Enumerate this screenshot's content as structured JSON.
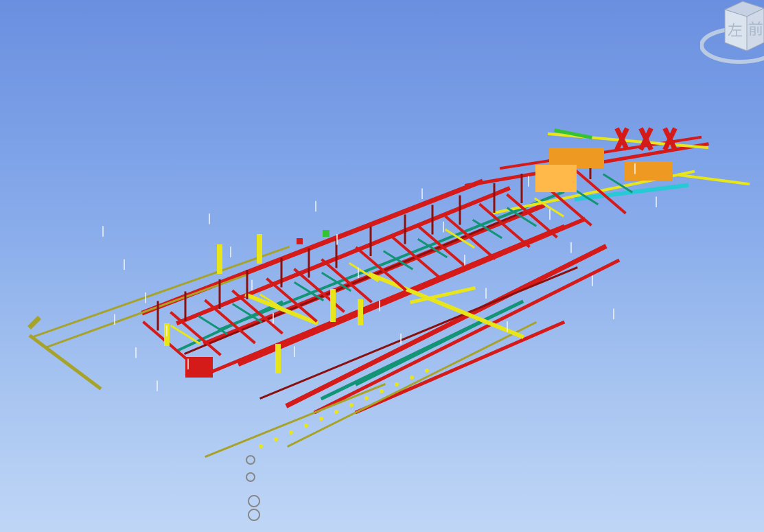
{
  "viewer": {
    "colors": {
      "background_top": "#6a8fe0",
      "background_bottom": "#bfd6f6",
      "fire_pipe": "#d51a1a",
      "fire_pipe_dark": "#8a1010",
      "hvac_duct": "#e8e61a",
      "water_pipe": "#149476",
      "cable_tray": "#a7a32a",
      "equipment": "#ee9a22",
      "green_pipe": "#36c236",
      "cyan_pipe": "#26c9d6"
    }
  },
  "viewcube": {
    "left_face": "左",
    "front_face": "前",
    "icon": "viewcube-icon"
  }
}
